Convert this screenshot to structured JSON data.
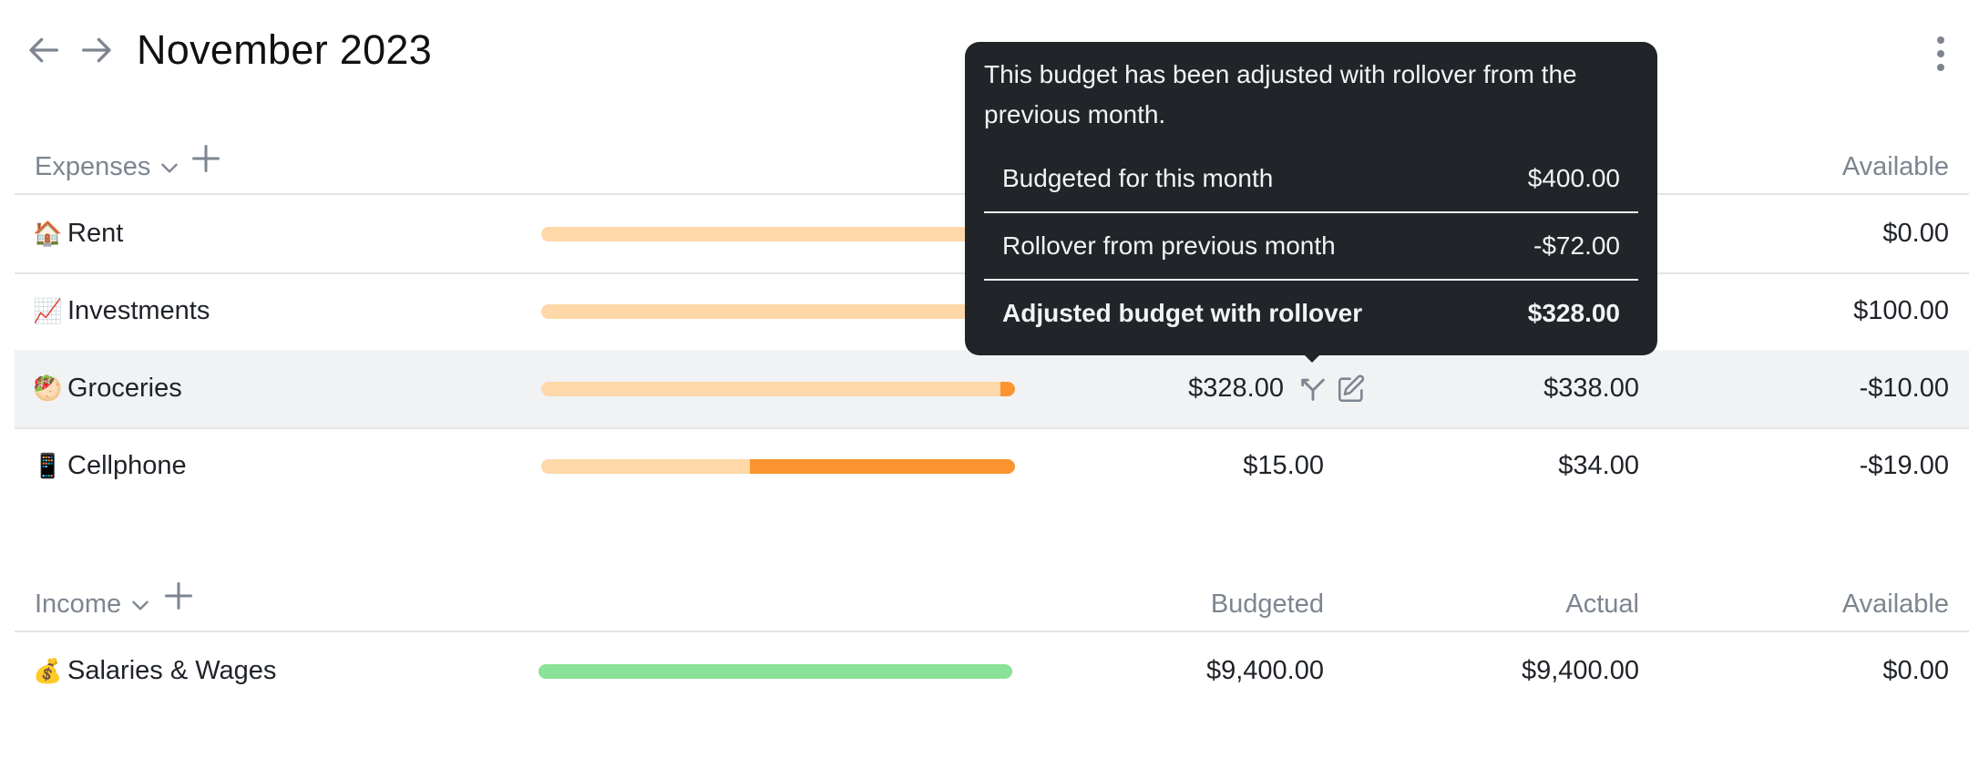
{
  "header": {
    "title": "November 2023",
    "back_icon": "arrow-left-icon",
    "forward_icon": "arrow-right-icon",
    "menu_icon": "more-vertical-icon"
  },
  "expenses": {
    "title": "Expenses",
    "columns": {
      "available": "Available"
    },
    "rows": [
      {
        "emoji": "🏠",
        "name": "Rent",
        "budgeted": "",
        "actual": "",
        "available": "$0.00",
        "spent_fraction": 1.0
      },
      {
        "emoji": "📈",
        "name": "Investments",
        "budgeted": "",
        "actual": "",
        "available": "$100.00",
        "spent_fraction": 1.0
      },
      {
        "emoji": "🥙",
        "name": "Groceries",
        "budgeted": "$328.00",
        "actual": "$338.00",
        "available": "-$10.00",
        "overspent_fraction": 0.03
      },
      {
        "emoji": "📱",
        "name": "Cellphone",
        "budgeted": "$15.00",
        "actual": "$34.00",
        "available": "-$19.00",
        "overspent_fraction": 0.56
      }
    ]
  },
  "income": {
    "title": "Income",
    "columns": {
      "budgeted": "Budgeted",
      "actual": "Actual",
      "available": "Available"
    },
    "rows": [
      {
        "emoji": "💰",
        "name": "Salaries & Wages",
        "budgeted": "$9,400.00",
        "actual": "$9,400.00",
        "available": "$0.00",
        "received_fraction": 1.0
      }
    ]
  },
  "tooltip": {
    "message": "This budget has been adjusted with rollover from the previous month.",
    "rows": [
      {
        "label": "Budgeted for this month",
        "value": "$400.00"
      },
      {
        "label": "Rollover from previous month",
        "value": "-$72.00"
      },
      {
        "label": "Adjusted budget with rollover",
        "value": "$328.00"
      }
    ]
  },
  "colors": {
    "expense_bar_bg": "#fed8a8",
    "expense_bar_over": "#fb9431",
    "income_bar": "#8ae297",
    "tooltip_bg": "#212428",
    "muted_text": "#7d8590"
  }
}
